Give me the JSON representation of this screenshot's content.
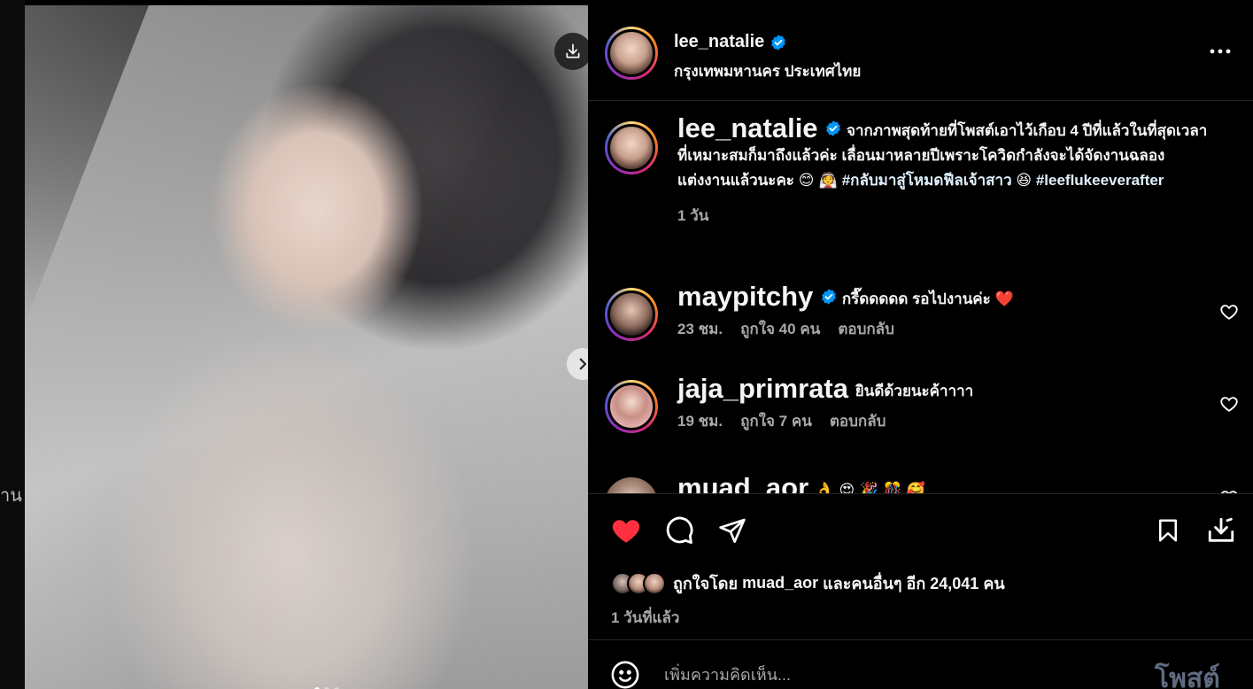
{
  "backdrop": {
    "partial_text": "าน"
  },
  "post": {
    "username": "lee_natalie",
    "location": "กรุงเทพมหานคร ประเทศไทย",
    "carousel_dots": 3,
    "carousel_active_index": 0
  },
  "caption": {
    "username": "lee_natalie",
    "text": "จากภาพสุดท้ายที่โพสต์เอาไว้เกือบ 4 ปีที่แล้วในที่สุดเวลาที่เหมาะสมก็มาถึงแล้วค่ะ เลื่อนมาหลายปีเพราะโควิดกำลังจะได้จัดงานฉลองแต่งงานแล้วนะคะ",
    "emoji": "😊 👰",
    "hashtag1": "#กลับมาสู่โหมดฟีลเจ้าสาว",
    "emoji_end": "😆",
    "hashtag2": "#leeflukeeverafter",
    "time": "1 วัน"
  },
  "comments": [
    {
      "username": "maypitchy",
      "verified": true,
      "text": "กรี๊ดดดดด รอไปงานค่ะ",
      "emoji": "❤️",
      "time": "23 ชม.",
      "likes": "ถูกใจ 40 คน",
      "reply": "ตอบกลับ"
    },
    {
      "username": "jaja_primrata",
      "verified": false,
      "text": "ยินดีด้วยนะค้าาาา",
      "time": "19 ชม.",
      "likes": "ถูกใจ 7 คน",
      "reply": "ตอบกลับ"
    },
    {
      "username": "muad_aor",
      "verified": false,
      "text": "👌 😍 🎉 🎊 🥰"
    }
  ],
  "likes": {
    "prefix": "ถูกใจโดย",
    "user": "muad_aor",
    "middle": "และ",
    "others": "คนอื่นๆ อีก 24,041 คน",
    "time": "1 วันที่แล้ว"
  },
  "comment_box": {
    "placeholder": "เพิ่มความคิดเห็น...",
    "post_label": "โพสต์"
  },
  "colors": {
    "like_red": "#ff3040",
    "verified_blue": "#0095f6",
    "post_button_disabled": "#5f6b80",
    "muted_text": "#a8a8a8"
  }
}
